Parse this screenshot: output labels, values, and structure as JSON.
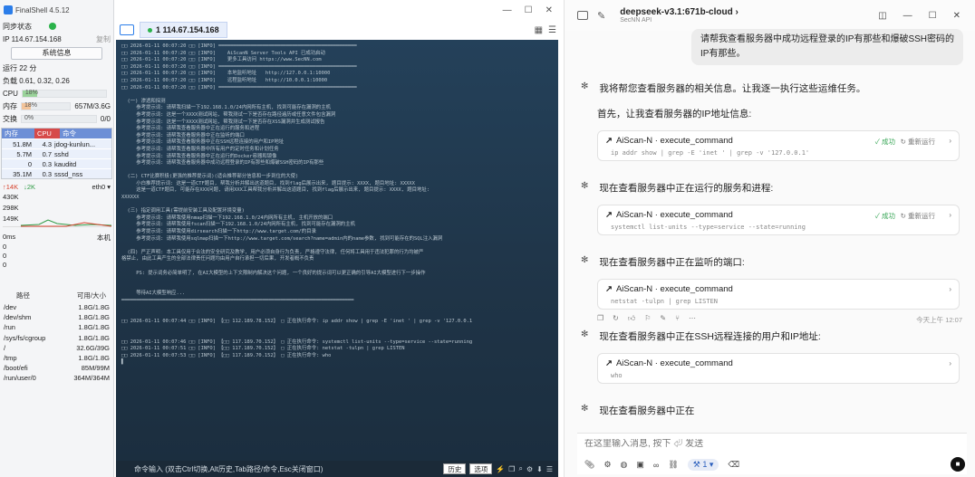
{
  "finalshell": {
    "app_title": "FinalShell 4.5.12",
    "sync_label": "同步状态",
    "ip_label": "IP",
    "ip_value": "114.67.154.168",
    "copy_label": "复制",
    "sysinfo_button": "系统信息",
    "uptime": "运行 22 分",
    "load": "负载 0.61, 0.32, 0.26",
    "cpu_label": "CPU",
    "cpu_text": "18%",
    "cpu_percent": 18,
    "mem_label": "内存",
    "mem_text": "18%",
    "mem_percent": 18,
    "mem_value": "657M/3.6G",
    "swap_label": "交换",
    "swap_text": "0%",
    "swap_percent": 0,
    "swap_value": "0/0",
    "proc_headers": [
      "内存",
      "CPU",
      "命令"
    ],
    "processes": [
      {
        "mem": "51.8M",
        "cpu": "4.3",
        "cmd": "jdog-kunlun..."
      },
      {
        "mem": "5.7M",
        "cpu": "0.7",
        "cmd": "sshd"
      },
      {
        "mem": "0",
        "cpu": "0.3",
        "cmd": "kauditd"
      },
      {
        "mem": "35.1M",
        "cpu": "0.3",
        "cmd": "sssd_nss"
      }
    ],
    "net_up": "↑14K",
    "net_down": "↓2K",
    "net_iface": "eth0",
    "net_scale": [
      "430K",
      "298K",
      "149K"
    ],
    "ping_label": "0ms",
    "ping_host": "本机",
    "ping_values": [
      "0",
      "0",
      "0"
    ],
    "disk_headers": [
      "路径",
      "可用/大小"
    ],
    "disks": [
      {
        "path": "/dev",
        "size": "1.8G/1.8G"
      },
      {
        "path": "/dev/shm",
        "size": "1.8G/1.8G"
      },
      {
        "path": "/run",
        "size": "1.8G/1.8G"
      },
      {
        "path": "/sys/fs/cgroup",
        "size": "1.8G/1.8G"
      },
      {
        "path": "/",
        "size": "32.6G/39G"
      },
      {
        "path": "/tmp",
        "size": "1.8G/1.8G"
      },
      {
        "path": "/boot/efi",
        "size": "85M/99M"
      },
      {
        "path": "/run/user/0",
        "size": "364M/364M"
      }
    ],
    "tab_label": "1 114.67.154.168",
    "terminal_lines": [
      "□□ 2026-01-11 00:07:20 □□ [INFO] ═══════════════════════════════════════════════",
      "□□ 2026-01-11 00:07:20 □□ [INFO]    AiScanN Server Tools API 已成功启动",
      "□□ 2026-01-11 00:07:20 □□ [INFO]    更多工具访问 https://www.SecNN.com",
      "□□ 2026-01-11 00:07:20 □□ [INFO] ═══════════════════════════════════════════════",
      "□□ 2026-01-11 00:07:20 □□ [INFO]    本地监听地址   http://127.0.0.1:10000",
      "□□ 2026-01-11 00:07:20 □□ [INFO]    远程监听地址   http://10.0.0.1:10000",
      "□□ 2026-01-11 00:07:20 □□ [INFO] ═══════════════════════════════════════════════",
      "",
      "  (一) 渗透和探测",
      "     参考提示词: 请帮我扫描一下192.168.1.0/24内网所有主机, 找到可能存在漏洞的主机",
      "     参考提示词: 这是一个XXXX测试网站, 帮我测试一下是否存在路径遍历或任意文件包含漏洞",
      "     参考提示词: 这是一个XXXX测试网站, 帮我测试一下是否存在XSS漏洞并生成测试报告",
      "     参考提示词: 请帮我查看服务器中正在运行的服务和进程",
      "     参考提示词: 请帮我查看服务器中正在监听的端口",
      "     参考提示词: 请帮我查看服务器中正在SSH远程连接的用户和IP地址",
      "     参考提示词: 请帮我查看服务器中所有用户的定时任务和计划任务",
      "     参考提示词: 请帮我查看服务器中正在运行的Docker容器和镜像",
      "     参考提示词: 请帮我查看服务器中成功远程登录的IP有那些和爆破SSH密码的IP有那些",
      "",
      "  (二) CTF比赛积极(更强的推荐提示词)(适合推荐部分信息和一步到位的大使)",
      "     小白推荐提示词: 这是一道CTF题目, 帮我分析并解出这道题目, 找到flag后展示出来, 题目提示: XXXX, 题目地址: XXXXX",
      "     这是一道CTF题目, 可能存在XXX问题, 请用XXX工具帮我分析并解出这道题目, 找到flag后展示出来, 题目提示: XXXX, 题目地址:",
      "XXXXXX",
      "",
      "  (三) 指定调用工具(需提前安装工具及配置环境变量)",
      "     参考提示词: 请帮我使用nmap扫描一下192.168.1.0/24内网所有主机, 主机开放的端口",
      "     参考提示词: 请帮我使用fscan扫描一下192.168.1.0/24内网所有主机, 找到可能存在漏洞的主机",
      "     参考提示词: 请帮我使用dirsearch扫描一下http://www.target.com/的目录",
      "     参考提示词: 请帮我使用sqlmap扫描一下http://www.target.com/search?name=admin内的name参数, 找到可能存在的SQL注入漏洞",
      "",
      "  (四) 严正声明: 本工具仅用于合法的安全研究及教学, 用户必须自身行为负责, 严格遵守法律, 任何将工具用于违法犯罪的行为均被严",
      "格禁止, 由此工具产生的全部法律责任问题均由用户自行承担一切后果, 开发者概不负责",
      "",
      "     PS: 提示词务必简单明了, 在AI大模型的上下文限制内解决这个问题, 一个良好的提示词可以更正确的引导AI大模型进行下一步操作",
      "",
      "",
      "     等待AI大模型响应...",
      "═══════════════════════════════════════════════════════════════════════════════",
      "",
      "",
      "□□ 2026-01-11 00:07:44 □□ [INFO] 【□□ 112.189.78.152】 □ 正在执行命令: ip addr show | grep -E 'inet ' | grep -v '127.0.0.1",
      "",
      "",
      "□□ 2026-01-11 00:07:46 □□ [INFO] 【□□ 117.189.70.152】 □ 正在执行命令: systemctl list-units --type=service --state=running",
      "□□ 2026-01-11 00:07:51 □□ [INFO] 【□□ 117.189.70.152】 □ 正在执行命令: netstat -tulpn | grep LISTEN",
      "□□ 2026-01-11 00:07:53 □□ [INFO] 【□□ 117.189.70.152】 □ 正在执行命令: who",
      "▌"
    ],
    "cmd_input_hint": "命令输入 (双击Ctrl切换,Alt历史,Tab路径/命令,Esc关闭窗口)",
    "history_button": "历史",
    "options_button": "选项"
  },
  "chat": {
    "model_name": "deepseek-v3.1:671b-cloud",
    "model_sub": "SecNN API",
    "user_message": "请帮我查看服务器中成功远程登录的IP有那些和爆破SSH密码的IP有那些。",
    "intro": "我将帮您查看服务器的相关信息。让我逐一执行这些运维任务。",
    "step1": "首先，让我查看服务器的IP地址信息:",
    "tools": [
      {
        "title": "AiScan-N · execute_command",
        "cmd": "ip addr show | grep -E 'inet ' | grep -v '127.0.0.1'",
        "status": "成功",
        "rerun": "重新运行"
      },
      {
        "title": "AiScan-N · execute_command",
        "cmd": "systemctl list-units --type=service --state=running",
        "status": "成功",
        "rerun": "重新运行"
      },
      {
        "title": "AiScan-N · execute_command",
        "cmd": "netstat -tulpn | grep LISTEN",
        "status": "",
        "rerun": ""
      },
      {
        "title": "AiScan-N · execute_command",
        "cmd": "who",
        "status": "",
        "rerun": ""
      }
    ],
    "step2": "现在查看服务器中正在运行的服务和进程:",
    "step3": "现在查看服务器中正在监听的端口:",
    "step4": "现在查看服务器中正在SSH远程连接的用户和IP地址:",
    "step5": "现在查看服务器中正在",
    "msg_time": "今天上午 12:07",
    "input_placeholder": "在这里输入消息, 按下 ⏎ 发送",
    "tool_pill": "1"
  }
}
